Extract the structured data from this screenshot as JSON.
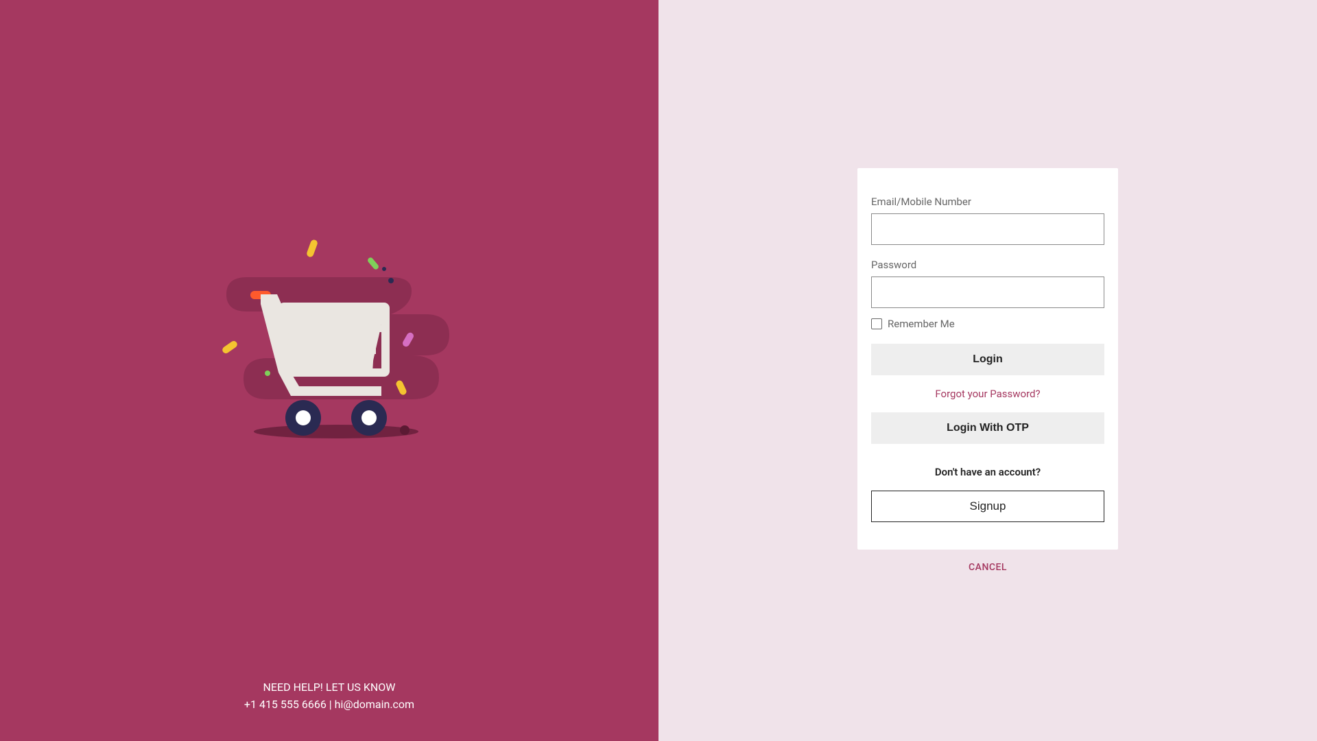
{
  "colors": {
    "brand": "#a53860",
    "panel_bg": "#f0e3ea"
  },
  "left": {
    "help_heading": "NEED HELP! LET US KNOW",
    "phone": "+1 415 555 6666",
    "separator": " | ",
    "email": "hi@domain.com",
    "illustration_alt": "shopping-cart"
  },
  "form": {
    "email_label": "Email/Mobile Number",
    "email_value": "",
    "password_label": "Password",
    "password_value": "",
    "remember_label": "Remember Me",
    "remember_checked": false,
    "login_button": "Login",
    "forgot_link": "Forgot your Password?",
    "otp_button": "Login With OTP",
    "signup_prompt": "Don't have an account?",
    "signup_button": "Signup",
    "cancel": "CANCEL"
  }
}
